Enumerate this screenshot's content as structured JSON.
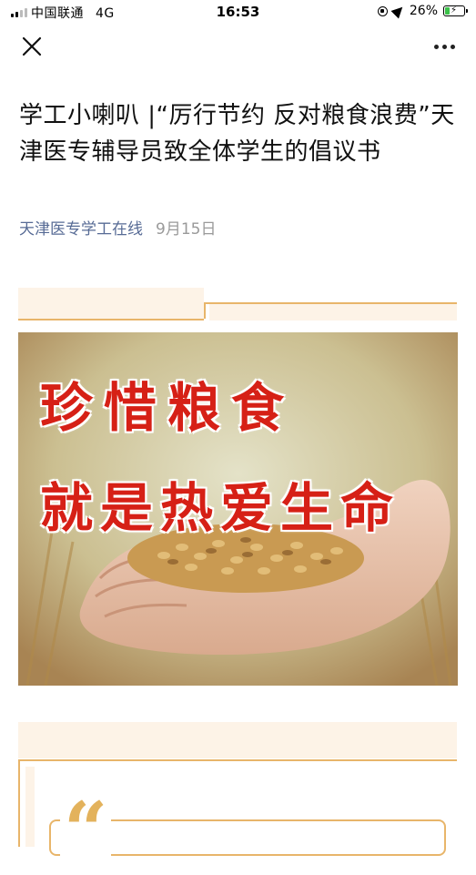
{
  "status_bar": {
    "carrier": "中国联通",
    "network": "4G",
    "time": "16:53",
    "battery": "26%",
    "battery_level": 0.26,
    "battery_color": "#3cc24a"
  },
  "nav": {
    "close_icon": "close-icon",
    "more_icon": "more-icon"
  },
  "article": {
    "title": "学工小喇叭 |“厉行节约 反对粮食浪费”天津医专辅导员致全体学生的倡议书",
    "account": "天津医专学工在线",
    "date": "9月15日",
    "image_text_line1": "珍惜粮食",
    "image_text_line2": "就是热爱生命",
    "quote_glyph": "“"
  },
  "colors": {
    "link": "#576b95",
    "accent": "#e8b56a",
    "frame_bg": "#fdf3e7",
    "image_text": "#d62016"
  }
}
